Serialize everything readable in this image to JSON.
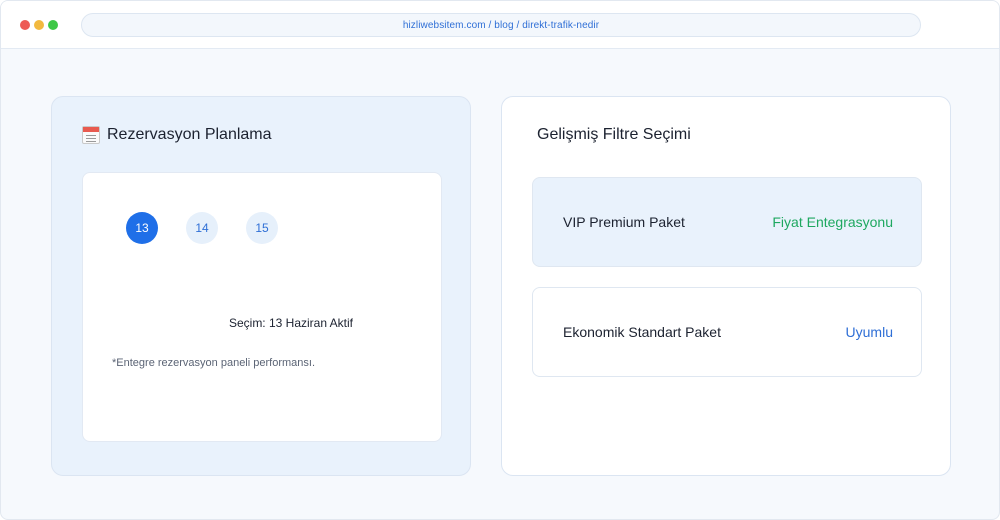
{
  "browser": {
    "url": "hizliwebsitem.com / blog / direkt-trafik-nedir"
  },
  "reservation": {
    "title": "Rezervasyon Planlama",
    "icon": "calendar-icon",
    "days": [
      "13",
      "14",
      "15"
    ],
    "selected_day": "13",
    "selection_text": "Seçim: 13 Haziran Aktif",
    "note": "*Entegre rezervasyon paneli performansı."
  },
  "filters": {
    "title": "Gelişmiş Filtre Seçimi",
    "options": [
      {
        "label": "VIP Premium Paket",
        "status": "Fiyat Entegrasyonu"
      },
      {
        "label": "Ekonomik Standart Paket",
        "status": "Uyumlu"
      }
    ]
  },
  "colors": {
    "accent": "#1f6fe8",
    "success": "#1ea860",
    "link": "#2f6fd6"
  }
}
